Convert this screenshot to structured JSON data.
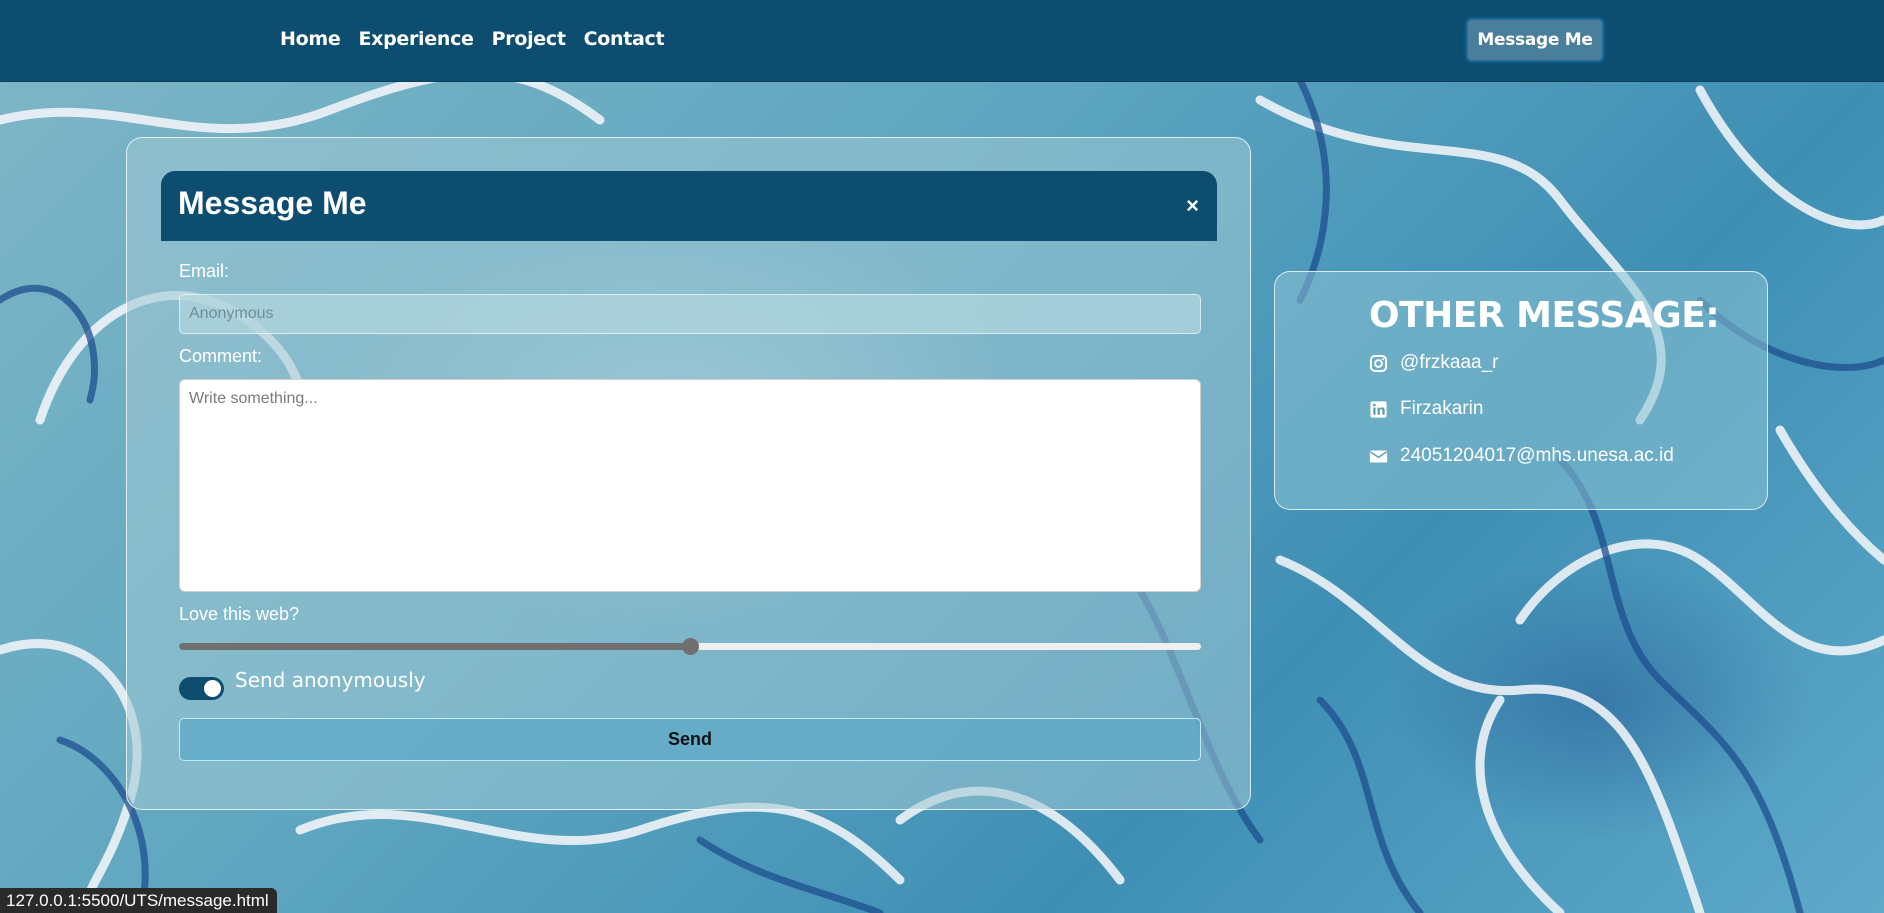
{
  "nav": {
    "links": [
      "Home",
      "Experience",
      "Project",
      "Contact"
    ],
    "cta_label": "Message Me"
  },
  "form": {
    "title": "Message Me",
    "close_symbol": "×",
    "email_label": "Email:",
    "email_placeholder": "Anonymous",
    "comment_label": "Comment:",
    "comment_placeholder": "Write something...",
    "love_label": "Love this web?",
    "love_value_fraction": 0.5,
    "anonymous_toggle_on": true,
    "anonymous_label": "Send anonymously",
    "send_label": "Send"
  },
  "contact": {
    "title": "OTHER MESSAGE:",
    "items": [
      {
        "icon": "instagram-icon",
        "text": "@frzkaaa_r"
      },
      {
        "icon": "linkedin-icon",
        "text": "Firzakarin"
      },
      {
        "icon": "envelope-icon",
        "text": "24051204017@mhs.unesa.ac.id"
      }
    ]
  },
  "status_url": "127.0.0.1:5500/UTS/message.html",
  "colors": {
    "navbar": "#0d4d70",
    "accent_border": "#1e6c98",
    "toggle_on": "#0d4d70"
  }
}
